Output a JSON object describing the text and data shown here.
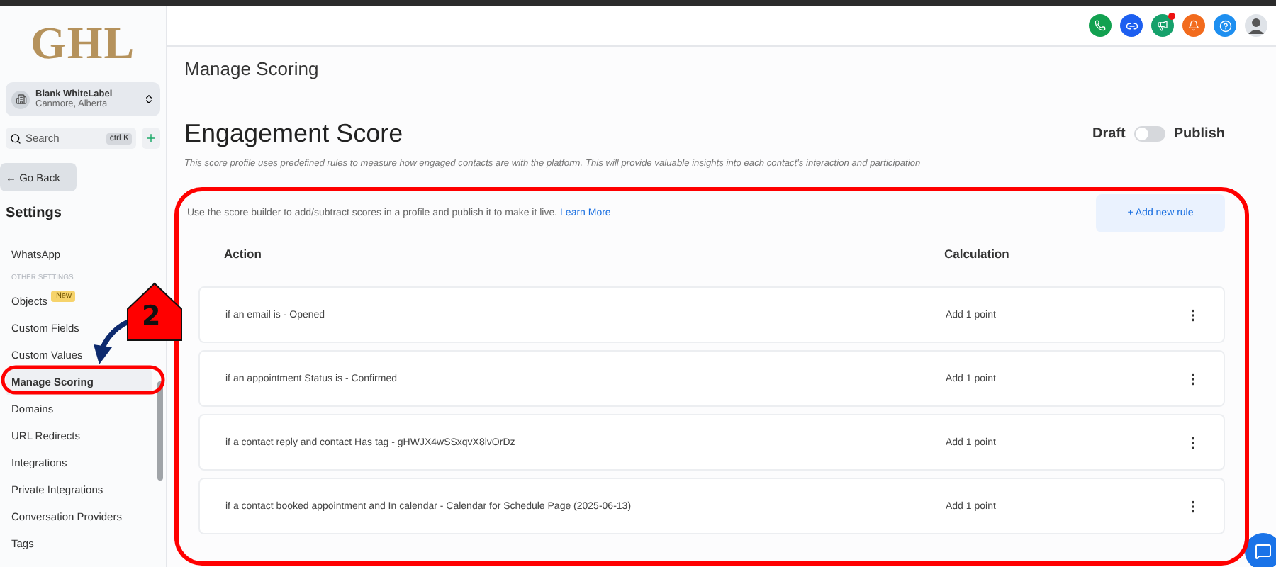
{
  "sidebar": {
    "logo": "GHL",
    "account": {
      "name": "Blank WhiteLabel",
      "location": "Canmore, Alberta"
    },
    "search": {
      "placeholder": "Search",
      "shortcut": "ctrl K"
    },
    "back_button": "← Go Back",
    "heading": "Settings",
    "items": [
      {
        "label": "WhatsApp",
        "kind": "item",
        "selected": false
      },
      {
        "label": "OTHER SETTINGS",
        "kind": "section"
      },
      {
        "label": "Objects",
        "kind": "item",
        "selected": false,
        "badge": "New"
      },
      {
        "label": "Custom Fields",
        "kind": "item",
        "selected": false
      },
      {
        "label": "Custom Values",
        "kind": "item",
        "selected": false
      },
      {
        "label": "Manage Scoring",
        "kind": "item",
        "selected": true
      },
      {
        "label": "Domains",
        "kind": "item",
        "selected": false
      },
      {
        "label": "URL Redirects",
        "kind": "item",
        "selected": false
      },
      {
        "label": "Integrations",
        "kind": "item",
        "selected": false
      },
      {
        "label": "Private Integrations",
        "kind": "item",
        "selected": false
      },
      {
        "label": "Conversation Providers",
        "kind": "item",
        "selected": false
      },
      {
        "label": "Tags",
        "kind": "item",
        "selected": false
      }
    ]
  },
  "header": {
    "notification_dot": true
  },
  "page_title": "Manage Scoring",
  "profile": {
    "title": "Engagement Score",
    "description": "This score profile uses predefined rules to measure how engaged contacts are with the platform. This will provide valuable insights into each contact's interaction and participation",
    "status": {
      "off_label": "Draft",
      "on_label": "Publish",
      "on": false
    }
  },
  "builder": {
    "hint": "Use the score builder to add/subtract scores in a profile and publish it to make it live.",
    "link": "Learn More",
    "add_button": "+ Add new rule",
    "columns": [
      "Action",
      "Calculation"
    ],
    "rows": [
      {
        "action": "if an email is - Opened",
        "calculation": "Add 1 point"
      },
      {
        "action": "if an appointment Status is - Confirmed",
        "calculation": "Add 1 point"
      },
      {
        "action": "if a contact reply and contact Has tag - gHWJX4wSSxqvX8ivOrDz",
        "calculation": "Add 1 point"
      },
      {
        "action": "if a contact booked appointment and In calendar - Calendar for Schedule Page (2025-06-13)",
        "calculation": "Add 1 point"
      }
    ]
  },
  "annotation": {
    "step": "2"
  }
}
